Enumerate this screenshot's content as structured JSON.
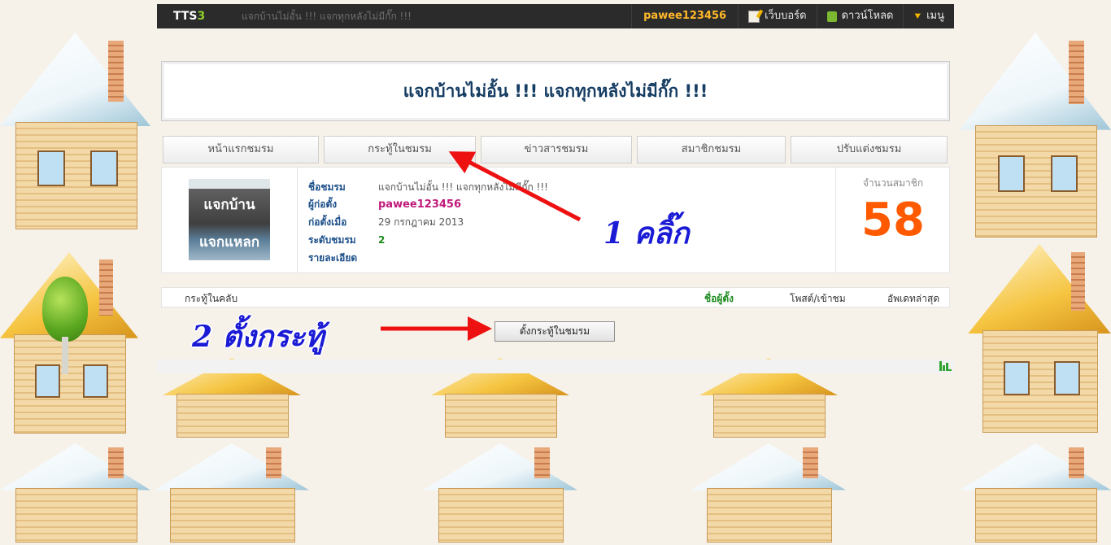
{
  "topbar": {
    "logo_text": "TTS",
    "logo_number": "3",
    "marquee": "แจกบ้านไม่อั้น !!! แจกทุกหลังไม่มีกั๊ก !!!",
    "username": "pawee123456",
    "links": [
      {
        "label": "เว็บบอร์ด",
        "icon": "webboard-icon"
      },
      {
        "label": "ดาวน์โหลด",
        "icon": "download-icon"
      },
      {
        "label": "เมนู",
        "icon": "menu-chevron-icon"
      }
    ]
  },
  "club": {
    "title": "แจกบ้านไม่อั้น !!! แจกทุกหลังไม่มีกั๊ก !!!",
    "avatar_text_1": "แจกบ้าน",
    "avatar_text_2": "แจกแหลก"
  },
  "tabs": [
    "หน้าแรกชมรม",
    "กระทู้ในชมรม",
    "ข่าวสารชมรม",
    "สมาชิกชมรม",
    "ปรับแต่งชมรม"
  ],
  "info": {
    "name_label": "ชื่อชมรม",
    "name_value": "แจกบ้านไม่อั้น !!! แจกทุกหลังไม่มีกั๊ก !!!",
    "founder_label": "ผู้ก่อตั้ง",
    "founder_value": "pawee123456",
    "founded_label": "ก่อตั้งเมื่อ",
    "founded_value": "29 กรกฎาคม 2013",
    "level_label": "ระดับชมรม",
    "level_value": "2",
    "detail_label": "รายละเอียด",
    "members_label": "จำนวนสมาชิก",
    "members_count": "58"
  },
  "table": {
    "col_topics": "กระทู้ในคลับ",
    "col_author": "ชื่อผู้ตั้ง",
    "col_posts_views": "โพสต์/เข้าชม",
    "col_updated": "อัพเดทล่าสุด"
  },
  "create_button": "ตั้งกระทู้ในชมรม",
  "annotations": {
    "step1": "1 คลิ๊ก",
    "step2": "2 ตั้งกระทู้",
    "arrow_color": "#ee1111"
  },
  "colors": {
    "accent_orange": "#ff5a00",
    "title_navy": "#153c62",
    "username_gold": "#ffb82a"
  }
}
